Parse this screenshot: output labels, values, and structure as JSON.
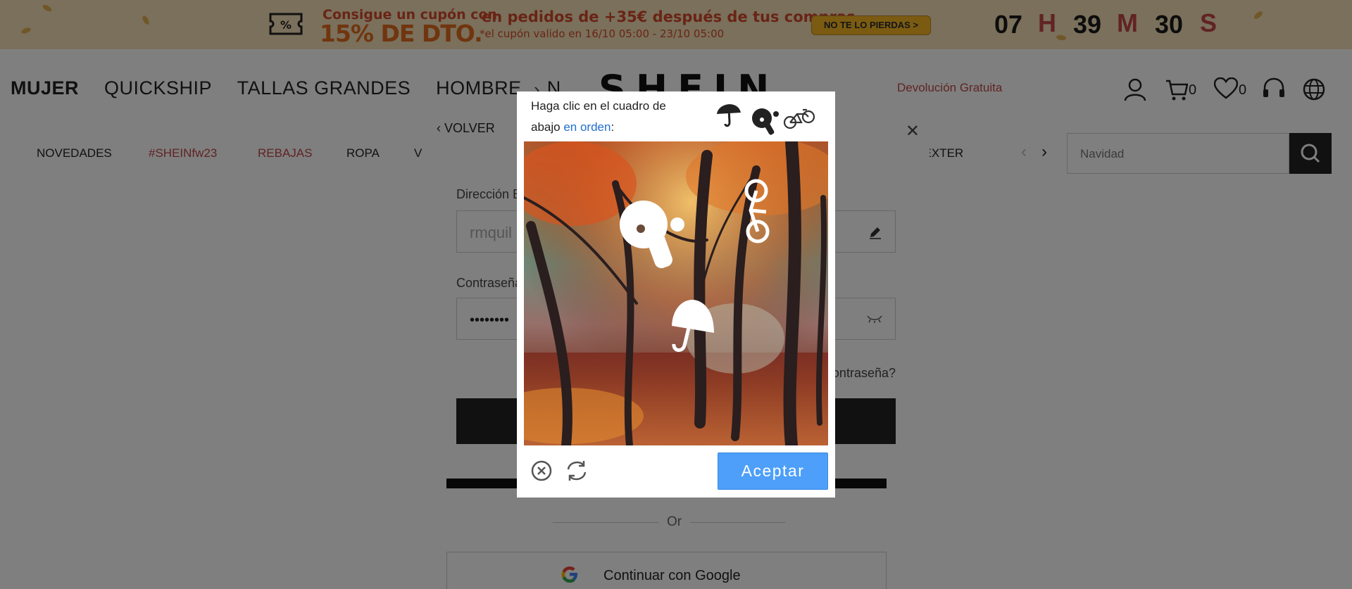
{
  "promo": {
    "line1": "Consigue un cupón con",
    "line2": "15% DE DTO.",
    "line3": "en pedidos de +35€ después de tus compras",
    "line4": "*el cupón valido en 16/10 05:00 - 23/10 05:00",
    "button": "NO TE LO PIERDAS >",
    "countdown": {
      "hours": "07",
      "h_unit": "H",
      "minutes": "39",
      "m_unit": "M",
      "seconds": "30",
      "s_unit": "S"
    },
    "unit_color": "#c24646"
  },
  "nav": {
    "items": [
      "MUJER",
      "QUICKSHIP",
      "TALLAS GRANDES",
      "HOMBRE",
      "N"
    ],
    "brand": "SHEIN",
    "free_returns": "Devolución Gratuita",
    "cart_count": "0",
    "wishlist_count": "0"
  },
  "categories": [
    "NOVEDADES",
    "#SHEINfw23",
    "REBAJAS",
    "ROPA",
    "V",
    "S Y EXTER"
  ],
  "category_accent": "#c24646",
  "search": {
    "placeholder": "Navidad"
  },
  "login": {
    "back": "VOLVER",
    "email_label": "Dirección E",
    "email_value": "rmquil",
    "password_label": "Contraseña",
    "password_value": "••••••••",
    "forgot": "ontraseña?",
    "or": "Or",
    "google": "Continuar con Google"
  },
  "captcha": {
    "prompt_a": "Haga clic en el cuadro de",
    "prompt_b": "abajo",
    "prompt_ordered": "en orden",
    "prompt_end": ":",
    "target_icons": [
      "umbrella-icon",
      "ping-pong-paddle-icon",
      "bicycle-icon"
    ],
    "accept": "Aceptar",
    "accent": "#4d9ff9"
  }
}
